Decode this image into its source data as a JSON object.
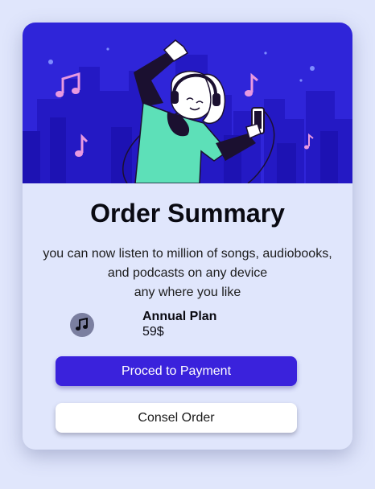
{
  "colors": {
    "page_background": "#e0e6fc",
    "hero_background": "#2f25d9",
    "primary_button": "#3a22dc",
    "secondary_button": "#ffffff",
    "music_note_accent": "#e899e0"
  },
  "hero": {
    "illustration": "person-dancing-with-headphones-city-skyline"
  },
  "title": "Order Summary",
  "description": {
    "line1": "you can now listen to million of songs, audiobooks,",
    "line2": "and podcasts on any device",
    "line3": "any where you like"
  },
  "plan": {
    "icon": "music-note-icon",
    "name": "Annual Plan",
    "price": "59$"
  },
  "buttons": {
    "proceed": "Proced to Payment",
    "cancel": "Consel Order"
  }
}
